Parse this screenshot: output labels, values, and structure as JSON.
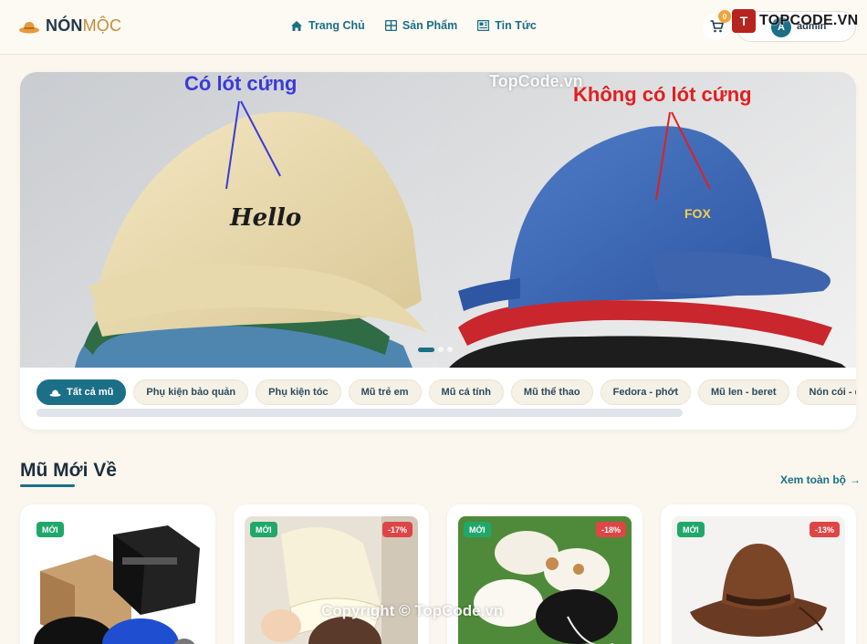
{
  "brand": {
    "logo_bold": "NÓN",
    "logo_light": "MỘC"
  },
  "nav": [
    {
      "label": "Trang Chủ",
      "icon": "home-icon"
    },
    {
      "label": "Sản Phẩm",
      "icon": "grid-icon"
    },
    {
      "label": "Tin Tức",
      "icon": "news-icon"
    }
  ],
  "cart": {
    "count": "0"
  },
  "user": {
    "initial": "A",
    "name": "admin"
  },
  "watermark": {
    "badge": "T",
    "text": "TOPCODE.VN",
    "mid": "TopCode.vn",
    "copyright": "Copyright © TopCode.vn"
  },
  "hero": {
    "left_caption": "Có lót cứng",
    "right_caption": "Không có lót cứng",
    "left_cap_text": "Hello",
    "right_cap_text": "FOX"
  },
  "categories": [
    "Tất cả mũ",
    "Phụ kiện bảo quản",
    "Phụ kiện tóc",
    "Mũ trẻ em",
    "Mũ cá tính",
    "Mũ thể thao",
    "Fedora - phớt",
    "Mũ len - beret",
    "Nón cói - đi b"
  ],
  "section": {
    "title": "Mũ Mới Về",
    "see_all": "Xem toàn bộ"
  },
  "products": [
    {
      "badge_new": "MỚI",
      "discount": ""
    },
    {
      "badge_new": "MỚI",
      "discount": "-17%"
    },
    {
      "badge_new": "MỚI",
      "discount": "-18%"
    },
    {
      "badge_new": "MỚI",
      "discount": "-13%"
    }
  ],
  "colors": {
    "primary": "#1b6f86",
    "background": "#fbf7ee",
    "new_badge": "#20a86b",
    "discount_badge": "#e04545"
  }
}
